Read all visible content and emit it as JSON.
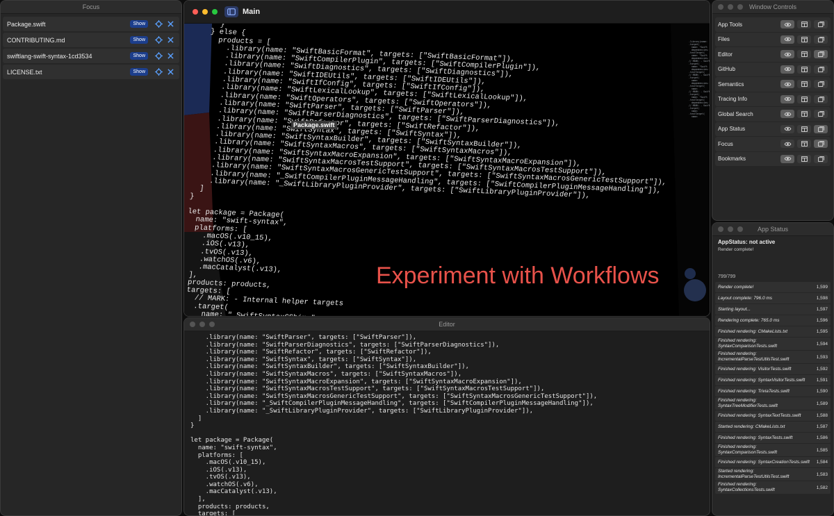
{
  "focus": {
    "title": "Focus",
    "show_label": "Show",
    "items": [
      "Package.swift",
      "CONTRIBUTING.md",
      "swiftlang-swift-syntax-1cd3534",
      "LICENSE.txt"
    ]
  },
  "main": {
    "title": "Main",
    "floating_label": "Package.swift",
    "overlay_text": "Experiment with Workflows",
    "code": "  }\n} else {\n  products = [\n    .library(name: \"SwiftBasicFormat\", targets: [\"SwiftBasicFormat\"]),\n    .library(name: \"SwiftCompilerPlugin\", targets: [\"SwiftCompilerPlugin\"]),\n    .library(name: \"SwiftDiagnostics\", targets: [\"SwiftDiagnostics\"]),\n    .library(name: \"SwiftIDEUtils\", targets: [\"SwiftIDEUtils\"]),\n    .library(name: \"SwiftIfConfig\", targets: [\"SwiftIfConfig\"]),\n    .library(name: \"SwiftLexicalLookup\", targets: [\"SwiftLexicalLookup\"]),\n    .library(name: \"SwiftOperators\", targets: [\"SwiftOperators\"]),\n    .library(name: \"SwiftParser\", targets: [\"SwiftParser\"]),\n    .library(name: \"SwiftParserDiagnostics\", targets: [\"SwiftParserDiagnostics\"]),\n    .library(name: \"SwiftRefactor\", targets: [\"SwiftRefactor\"]),\n    .library(name: \"SwiftSyntax\", targets: [\"SwiftSyntax\"]),\n    .library(name: \"SwiftSyntaxBuilder\", targets: [\"SwiftSyntaxBuilder\"]),\n    .library(name: \"SwiftSyntaxMacros\", targets: [\"SwiftSyntaxMacros\"]),\n    .library(name: \"SwiftSyntaxMacroExpansion\", targets: [\"SwiftSyntaxMacroExpansion\"]),\n    .library(name: \"SwiftSyntaxMacrosTestSupport\", targets: [\"SwiftSyntaxMacrosTestSupport\"]),\n    .library(name: \"SwiftSyntaxMacrosGenericTestSupport\", targets: [\"SwiftSyntaxMacrosGenericTestSupport\"]),\n    .library(name: \"_SwiftCompilerPluginMessageHandling\", targets: [\"SwiftCompilerPluginMessageHandling\"]),\n    .library(name: \"_SwiftLibraryPluginProvider\", targets: [\"SwiftLibraryPluginProvider\"]),\n  ]\n}\n\nlet package = Package(\n  name: \"swift-syntax\",\n  platforms: [\n    .macOS(.v10_15),\n    .iOS(.v13),\n    .tvOS(.v13),\n    .watchOS(.v6),\n    .macCatalyst(.v13),\n  ],\n  products: products,\n  targets: [\n    // MARK: - Internal helper targets\n    .target(\n      name: \"_SwiftSyntaxCShims\"\n    ),\n\n    .target(\n      name: \"_InstructionCounter\"\n    ),\n\n    .target(\n      name: \"SwiftSyntaxTestSupport\","
  },
  "editor": {
    "title": "Editor",
    "code": "    .library(name: \"SwiftParser\", targets: [\"SwiftParser\"]),\n    .library(name: \"SwiftParserDiagnostics\", targets: [\"SwiftParserDiagnostics\"]),\n    .library(name: \"SwiftRefactor\", targets: [\"SwiftRefactor\"]),\n    .library(name: \"SwiftSyntax\", targets: [\"SwiftSyntax\"]),\n    .library(name: \"SwiftSyntaxBuilder\", targets: [\"SwiftSyntaxBuilder\"]),\n    .library(name: \"SwiftSyntaxMacros\", targets: [\"SwiftSyntaxMacros\"]),\n    .library(name: \"SwiftSyntaxMacroExpansion\", targets: [\"SwiftSyntaxMacroExpansion\"]),\n    .library(name: \"SwiftSyntaxMacrosTestSupport\", targets: [\"SwiftSyntaxMacrosTestSupport\"]),\n    .library(name: \"SwiftSyntaxMacrosGenericTestSupport\", targets: [\"SwiftSyntaxMacrosGenericTestSupport\"]),\n    .library(name: \"_SwiftCompilerPluginMessageHandling\", targets: [\"SwiftCompilerPluginMessageHandling\"]),\n    .library(name: \"_SwiftLibraryPluginProvider\", targets: [\"SwiftLibraryPluginProvider\"]),\n  ]\n}\n\nlet package = Package(\n  name: \"swift-syntax\",\n  platforms: [\n    .macOS(.v10_15),\n    .iOS(.v13),\n    .tvOS(.v13),\n    .watchOS(.v6),\n    .macCatalyst(.v13),\n  ],\n  products: products,\n  targets: ["
  },
  "window_controls": {
    "title": "Window Controls",
    "rows": [
      {
        "label": "App Tools",
        "active": [
          true,
          false,
          false
        ]
      },
      {
        "label": "Files",
        "active": [
          true,
          false,
          false
        ]
      },
      {
        "label": "Editor",
        "active": [
          true,
          false,
          true
        ]
      },
      {
        "label": "GitHub",
        "active": [
          true,
          false,
          false
        ]
      },
      {
        "label": "Semantics",
        "active": [
          true,
          false,
          false
        ]
      },
      {
        "label": "Tracing Info",
        "active": [
          true,
          false,
          false
        ]
      },
      {
        "label": "Global Search",
        "active": [
          true,
          false,
          false
        ]
      },
      {
        "label": "App Status",
        "active": [
          false,
          false,
          true
        ]
      },
      {
        "label": "Focus",
        "active": [
          false,
          false,
          true
        ]
      },
      {
        "label": "Bookmarks",
        "active": [
          true,
          false,
          false
        ]
      }
    ]
  },
  "app_status": {
    "title": "App Status",
    "status": "AppStatus: not active",
    "substatus": "Render complete!",
    "count": "799/799",
    "log": [
      {
        "msg": "Render complete!",
        "num": "1,599"
      },
      {
        "msg": "Layout complete: 796.0 ms",
        "num": "1,598"
      },
      {
        "msg": "Starting layout...",
        "num": "1,597"
      },
      {
        "msg": "Rendering complete: 765.0 ms",
        "num": "1,596"
      },
      {
        "msg": "Finished rendering: CMakeLists.txt",
        "num": "1,595"
      },
      {
        "msg": "Finished rendering: SyntaxComparisonTests.swift",
        "num": "1,594"
      },
      {
        "msg": "Finished rendering: IncrementalParseTestUtilsTest.swift",
        "num": "1,593"
      },
      {
        "msg": "Finished rendering: VisitorTests.swift",
        "num": "1,592"
      },
      {
        "msg": "Finished rendering: SyntaxVisitorTests.swift",
        "num": "1,591"
      },
      {
        "msg": "Finished rendering: TriviaTests.swift",
        "num": "1,590"
      },
      {
        "msg": "Finished rendering: SyntaxTreeModifierTests.swift",
        "num": "1,589"
      },
      {
        "msg": "Finished rendering: SyntaxTextTests.swift",
        "num": "1,588"
      },
      {
        "msg": "Started rendering: CMakeLists.txt",
        "num": "1,587"
      },
      {
        "msg": "Finished rendering: SyntaxTests.swift",
        "num": "1,586"
      },
      {
        "msg": "Finished rendering: SyntaxComparisonTests.swift",
        "num": "1,585"
      },
      {
        "msg": "Finished rendering: SyntaxCreationTests.swift",
        "num": "1,584"
      },
      {
        "msg": "Started rendering: IncrementalParseTestUtilsTest.swift",
        "num": "1,583"
      },
      {
        "msg": "Finished rendering: SyntaxCollectionsTests.swift",
        "num": "1,582"
      }
    ]
  }
}
